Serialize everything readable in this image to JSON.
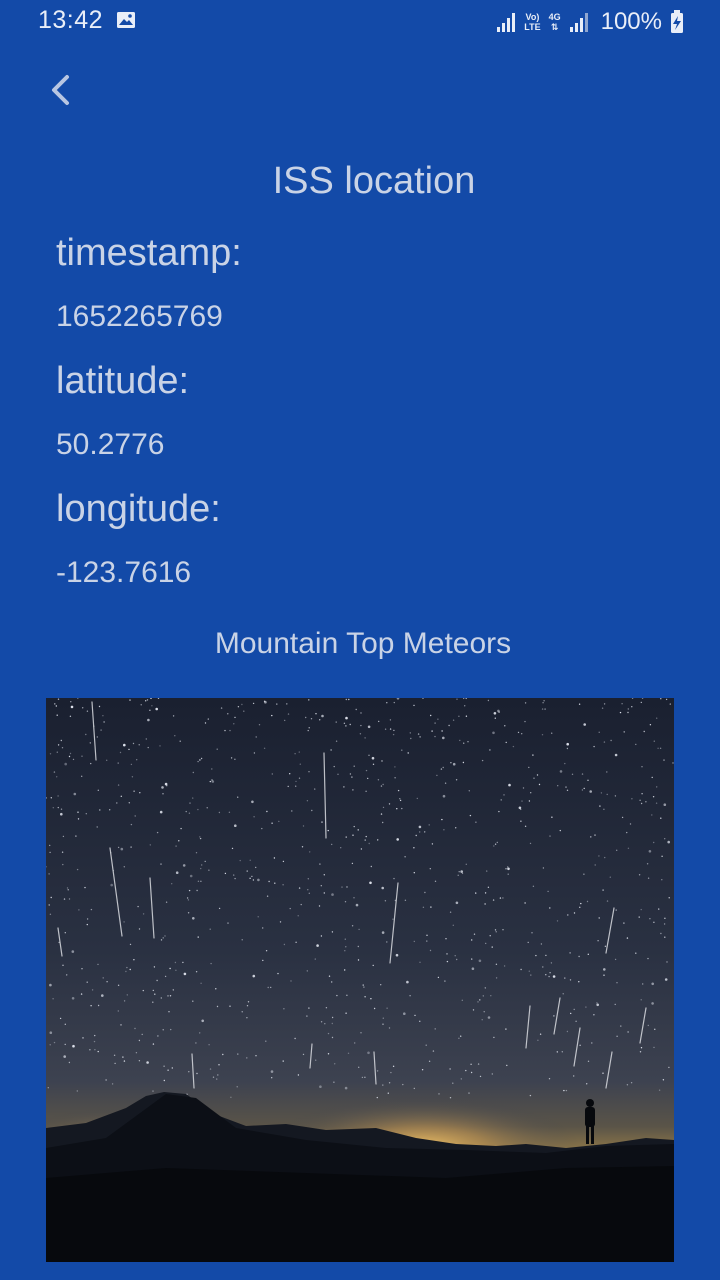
{
  "status_bar": {
    "time": "13:42",
    "network_label_top": "Vo)",
    "network_label_bottom": "LTE",
    "network_4g": "4G",
    "battery": "100%",
    "icons": [
      "gallery-icon",
      "signal-icon",
      "volte-icon",
      "4g-icon",
      "signal-icon",
      "battery-charging-icon"
    ]
  },
  "nav": {
    "back_icon": "chevron-left-icon"
  },
  "page": {
    "title": "ISS location"
  },
  "fields": {
    "timestamp_label": "timestamp:",
    "timestamp_value": "1652265769",
    "latitude_label": "latitude:",
    "latitude_value": "50.2776",
    "longitude_label": "longitude:",
    "longitude_value": "-123.7616"
  },
  "image": {
    "caption": "Mountain Top Meteors"
  },
  "colors": {
    "background": "#134aa8",
    "text": "#c9d3e6"
  }
}
